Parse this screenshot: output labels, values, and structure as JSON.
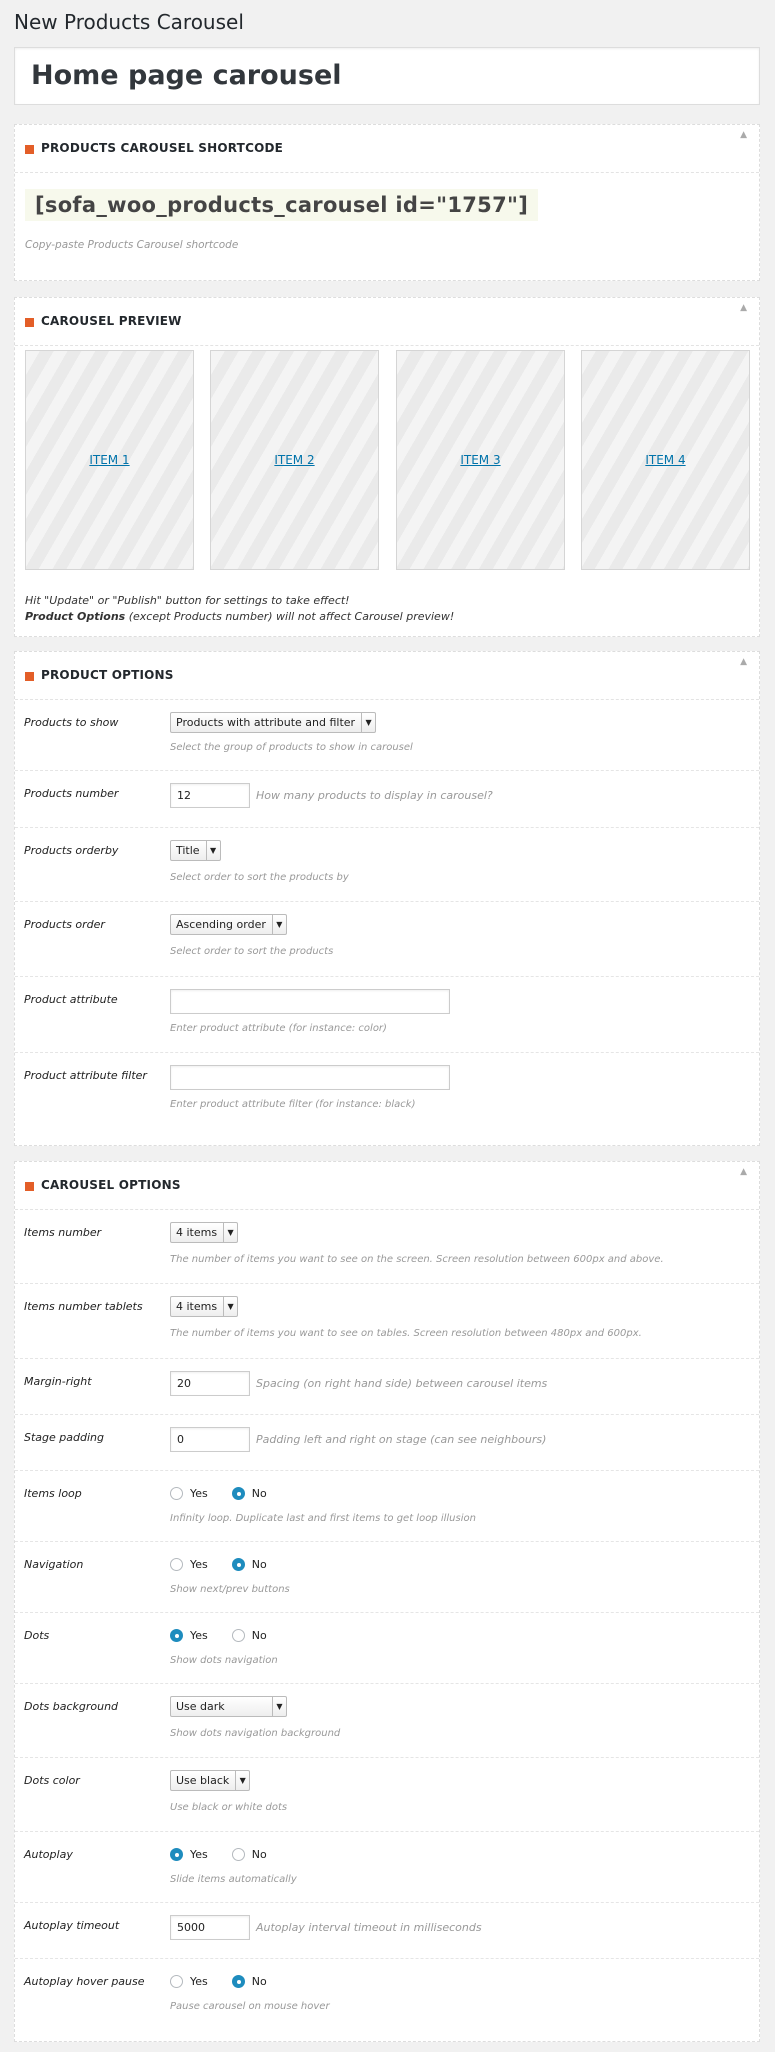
{
  "page_title": "New Products Carousel",
  "post_title": "Home page carousel",
  "shortcode_box": {
    "heading": "PRODUCTS CAROUSEL SHORTCODE",
    "shortcode": "[sofa_woo_products_carousel id=\"1757\"]",
    "help": "Copy-paste Products Carousel shortcode"
  },
  "preview_box": {
    "heading": "CAROUSEL PREVIEW",
    "items": [
      "ITEM 1",
      "ITEM 2",
      "ITEM 3",
      "ITEM 4"
    ],
    "note1": "Hit \"Update\" or \"Publish\" button for settings to take effect!",
    "note2_bold": "Product Options",
    "note2_rest": " (except Products number) will not affect Carousel preview!"
  },
  "product_options": {
    "heading": "PRODUCT OPTIONS",
    "products_to_show": {
      "label": "Products to show",
      "value": "Products with attribute and filter",
      "help": "Select the group of products to show in carousel"
    },
    "products_number": {
      "label": "Products number",
      "value": "12",
      "help": "How many products to display in carousel?"
    },
    "products_orderby": {
      "label": "Products orderby",
      "value": "Title",
      "help": "Select order to sort the products by"
    },
    "products_order": {
      "label": "Products order",
      "value": "Ascending order",
      "help": "Select order to sort the products"
    },
    "product_attribute": {
      "label": "Product attribute",
      "value": "",
      "help": "Enter product attribute (for instance: color)"
    },
    "product_attribute_filter": {
      "label": "Product attribute filter",
      "value": "",
      "help": "Enter product attribute filter (for instance: black)"
    }
  },
  "carousel_options": {
    "heading": "CAROUSEL OPTIONS",
    "yes": "Yes",
    "no": "No",
    "items_number": {
      "label": "Items number",
      "value": "4 items",
      "help": "The number of items you want to see on the screen. Screen resolution between 600px and above."
    },
    "items_number_tablets": {
      "label": "Items number tablets",
      "value": "4 items",
      "help": "The number of items you want to see on tables. Screen resolution between 480px and 600px."
    },
    "margin_right": {
      "label": "Margin-right",
      "value": "20",
      "help": "Spacing (on right hand side) between carousel items"
    },
    "stage_padding": {
      "label": "Stage padding",
      "value": "0",
      "help": "Padding left and right on stage (can see neighbours)"
    },
    "items_loop": {
      "label": "Items loop",
      "selected": "No",
      "help": "Infinity loop. Duplicate last and first items to get loop illusion"
    },
    "navigation": {
      "label": "Navigation",
      "selected": "No",
      "help": "Show next/prev buttons"
    },
    "dots": {
      "label": "Dots",
      "selected": "Yes",
      "help": "Show dots navigation"
    },
    "dots_background": {
      "label": "Dots background",
      "value": "Use dark",
      "help": "Show dots navigation background"
    },
    "dots_color": {
      "label": "Dots color",
      "value": "Use black",
      "help": "Use black or white dots"
    },
    "autoplay": {
      "label": "Autoplay",
      "selected": "Yes",
      "help": "Slide items automatically"
    },
    "autoplay_timeout": {
      "label": "Autoplay timeout",
      "value": "5000",
      "help": "Autoplay interval timeout in milliseconds"
    },
    "autoplay_hover_pause": {
      "label": "Autoplay hover pause",
      "selected": "No",
      "help": "Pause carousel on mouse hover"
    }
  },
  "colors": {
    "accent": "#e35e28",
    "link": "#0073aa",
    "radio_on": "#1e8cbe"
  },
  "icons": {
    "section_marker": "square-icon",
    "toggle": "collapse-arrow-icon",
    "select_arrow": "caret-down-icon"
  }
}
